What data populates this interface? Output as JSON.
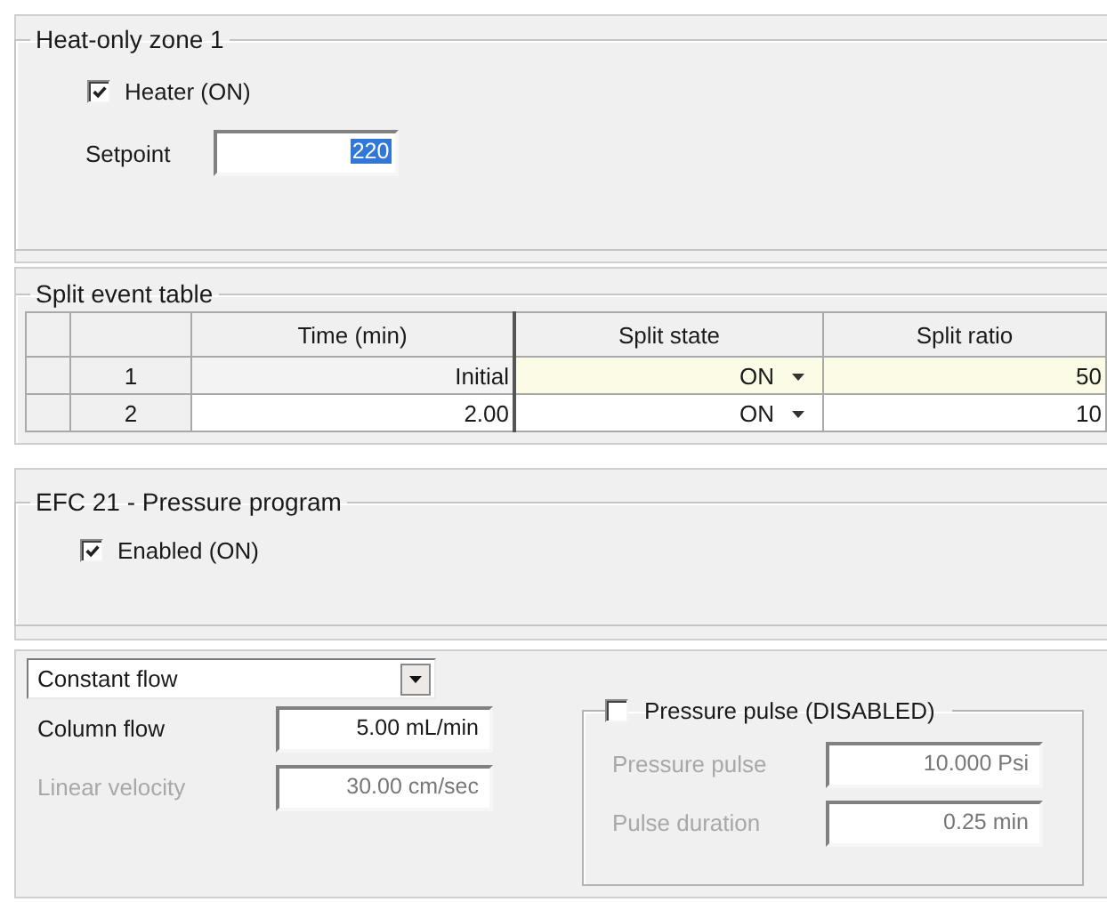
{
  "heat_zone": {
    "title": "Heat-only zone 1",
    "heater": {
      "label": "Heater (ON)",
      "checked": true
    },
    "setpoint": {
      "label": "Setpoint",
      "value": "220",
      "selected": true
    }
  },
  "split_table": {
    "title": "Split event table",
    "columns": [
      "Time (min)",
      "Split state",
      "Split ratio"
    ],
    "rows": [
      {
        "index": "1",
        "time": "Initial",
        "state": "ON",
        "ratio": "50",
        "selected": true
      },
      {
        "index": "2",
        "time": "2.00",
        "state": "ON",
        "ratio": "10",
        "selected": false
      }
    ]
  },
  "efc": {
    "title": "EFC 21 - Pressure program",
    "enabled": {
      "label": "Enabled (ON)",
      "checked": true
    }
  },
  "flow": {
    "mode": "Constant flow",
    "fields": [
      {
        "label": "Column flow",
        "value": "5.00 mL/min",
        "disabled": false
      },
      {
        "label": "Linear velocity",
        "value": "30.00 cm/sec",
        "disabled": true
      }
    ],
    "pulse": {
      "label": "Pressure pulse (DISABLED)",
      "checked": false,
      "fields": [
        {
          "label": "Pressure pulse",
          "value": "10.000 Psi",
          "disabled": true
        },
        {
          "label": "Pulse duration",
          "value": "0.25 min",
          "disabled": true
        }
      ]
    }
  }
}
